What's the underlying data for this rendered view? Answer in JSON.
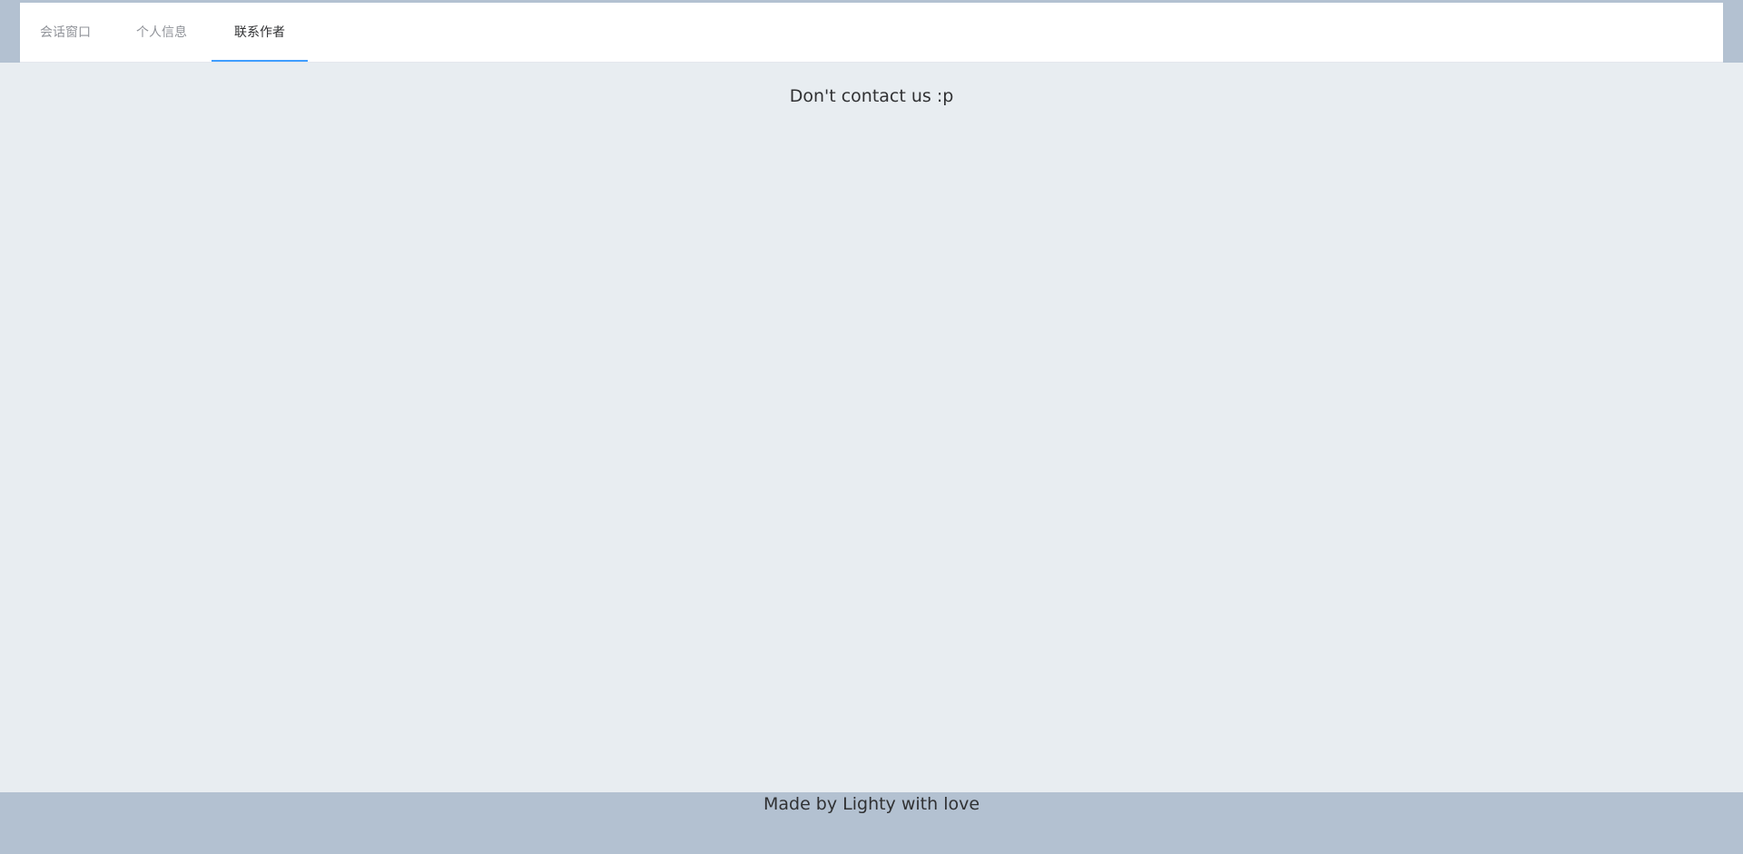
{
  "tabs": {
    "items": [
      {
        "label": "会话窗口"
      },
      {
        "label": "个人信息"
      },
      {
        "label": "联系作者"
      }
    ],
    "active_index": 2
  },
  "main": {
    "message": "Don't contact us :p"
  },
  "footer": {
    "text": "Made by Lighty with love"
  },
  "colors": {
    "header_band": "#b3c1d1",
    "main_background": "#e8edf1",
    "tab_active_indicator": "#409eff",
    "tab_inactive_text": "#909399",
    "tab_active_text": "#303133"
  }
}
